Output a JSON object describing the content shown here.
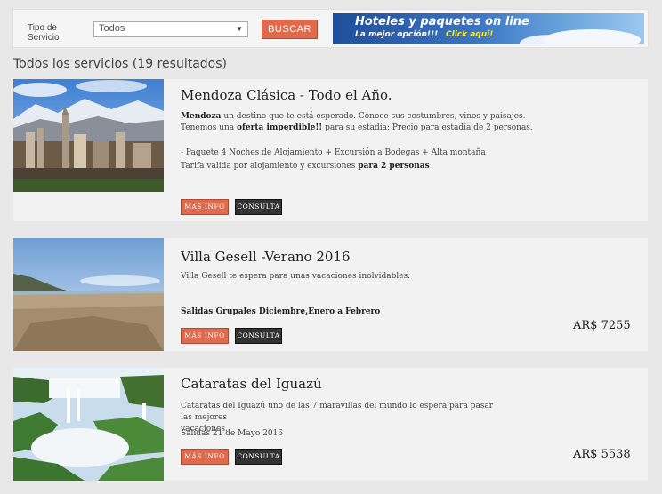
{
  "search": {
    "type_label": "Tipo de Servicio",
    "type_line1": "Tipo de",
    "type_line2": "Servicio",
    "select_value": "Todos",
    "button_label": "BUSCAR"
  },
  "banner": {
    "title": "Hoteles y paquetes on line",
    "subtitle": "La mejor opción!!!",
    "cta": "Click aquí!"
  },
  "results": {
    "heading": "Todos los servicios (19 resultados)"
  },
  "colors": {
    "accent": "#e06a4e",
    "dark_button": "#333333",
    "background": "#e8e8e8",
    "card": "#f2f2f2",
    "banner": "#2a5fae"
  },
  "cards": [
    {
      "title": "Mendoza Clásica - Todo el Año.",
      "line1_bold": "Mendoza",
      "line1_rest": " un destino que te está esperado. Conoce sus costumbres, vinos y paisajes.",
      "line2_pre": "Tenemos una ",
      "line2_bold": "oferta imperdible!!",
      "line2_rest": " para su estadía: Precio para estadía de 2 personas.",
      "line3": "- Paquete 4 Noches de Alojamiento + Excursión a Bodegas + Alta montaña",
      "line4_pre": "Tarifa valida por alojamiento y excursiones ",
      "line4_bold": "para 2 personas",
      "info_label": "MÁS INFO",
      "consult_label": "CONSULTA",
      "image": "mendoza-city-photo"
    },
    {
      "title": "Villa Gesell -Verano 2016",
      "line1": "Villa Gesell te espera para unas vacaciones inolvidables.",
      "line2_bold": "Salidas Grupales Diciembre,Enero a Febrero",
      "info_label": "MÁS INFO",
      "consult_label": "CONSULTA",
      "price": "AR$ 7255",
      "image": "villa-gesell-dunes-photo"
    },
    {
      "title": "Cataratas del Iguazú",
      "line1": "Cataratas del Iguazú uno de las 7 maravillas del mundo lo espera para pasar las mejores",
      "line2": "vacaciones.",
      "line3": "Salidas 21 de Mayo 2016",
      "info_label": "MÁS INFO",
      "consult_label": "CONSULTA",
      "price": "AR$ 5538",
      "image": "iguazu-falls-photo"
    }
  ]
}
